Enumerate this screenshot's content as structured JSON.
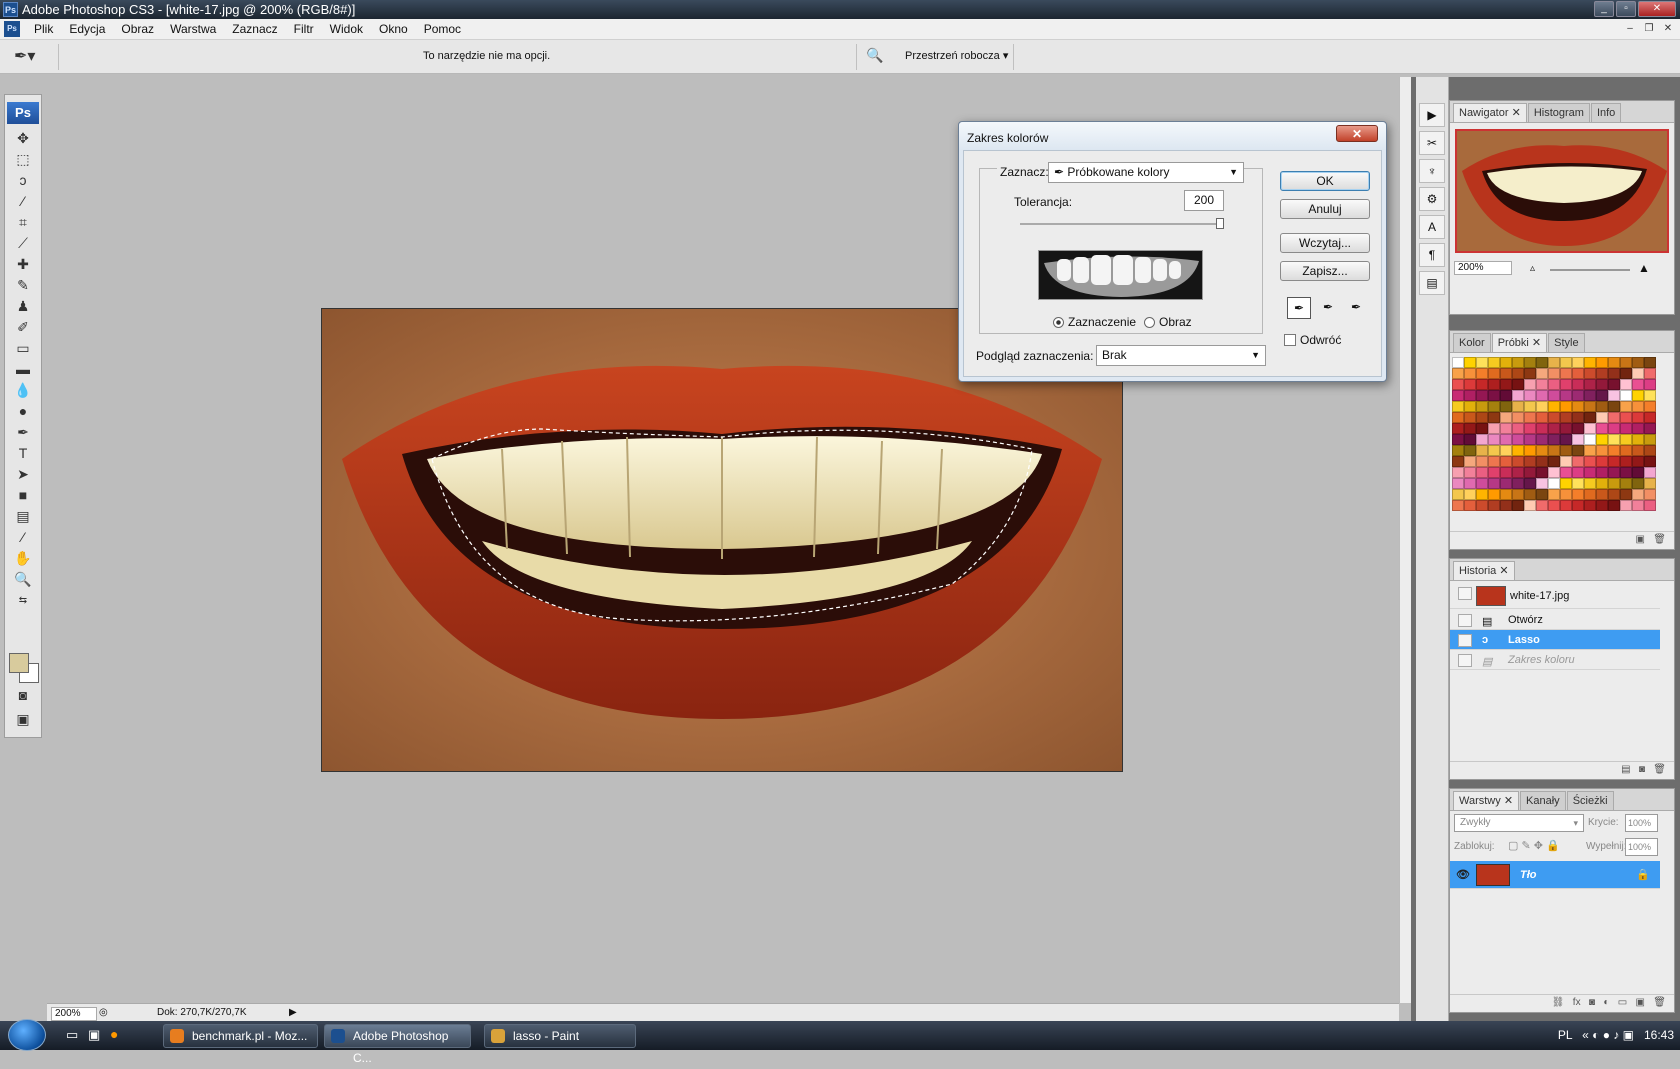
{
  "app": {
    "title": "Adobe Photoshop CS3 - [white-17.jpg @ 200% (RGB/8#)]"
  },
  "menu": [
    "Plik",
    "Edycja",
    "Obraz",
    "Warstwa",
    "Zaznacz",
    "Filtr",
    "Widok",
    "Okno",
    "Pomoc"
  ],
  "options": {
    "message": "To narzędzie nie ma opcji.",
    "workspace": "Przestrzeń robocza"
  },
  "status": {
    "zoom": "200%",
    "doc": "Dok: 270,7K/270,7K"
  },
  "dialog": {
    "title": "Zakres kolorów",
    "select_label": "Zaznacz:",
    "select_value": "Próbkowane kolory",
    "tolerance_label": "Tolerancja:",
    "tolerance_value": "200",
    "tolerance_level": 1.0,
    "radio_selection": "Zaznaczenie",
    "radio_image": "Obraz",
    "preview_label": "Podgląd zaznaczenia:",
    "preview_value": "Brak",
    "invert": "Odwróć",
    "buttons": {
      "ok": "OK",
      "cancel": "Anuluj",
      "load": "Wczytaj...",
      "save": "Zapisz..."
    }
  },
  "navigator": {
    "tabs": [
      "Nawigator",
      "Histogram",
      "Info"
    ],
    "zoom": "200%"
  },
  "swatches": {
    "tabs": [
      "Kolor",
      "Próbki",
      "Style"
    ]
  },
  "history": {
    "tabs": [
      "Historia"
    ],
    "snapshot": "white-17.jpg",
    "items": [
      {
        "label": "Otwórz",
        "state": "normal"
      },
      {
        "label": "Lasso",
        "state": "selected"
      },
      {
        "label": "Zakres koloru",
        "state": "dimmed"
      }
    ]
  },
  "layers": {
    "tabs": [
      "Warstwy",
      "Kanały",
      "Ścieżki"
    ],
    "blend_mode": "Zwykły",
    "opacity_label": "Krycie:",
    "opacity": "100%",
    "lock_label": "Zablokuj:",
    "fill_label": "Wypełnij:",
    "fill": "100%",
    "layer_name": "Tło"
  },
  "taskbar": {
    "items": [
      "benchmark.pl - Moz...",
      "Adobe Photoshop C...",
      "lasso - Paint"
    ],
    "lang": "PL",
    "time": "16:43"
  },
  "colors": {
    "accent": "#3e9cf2",
    "foreground": "#d8cb9d",
    "lip": "#b8341c"
  }
}
